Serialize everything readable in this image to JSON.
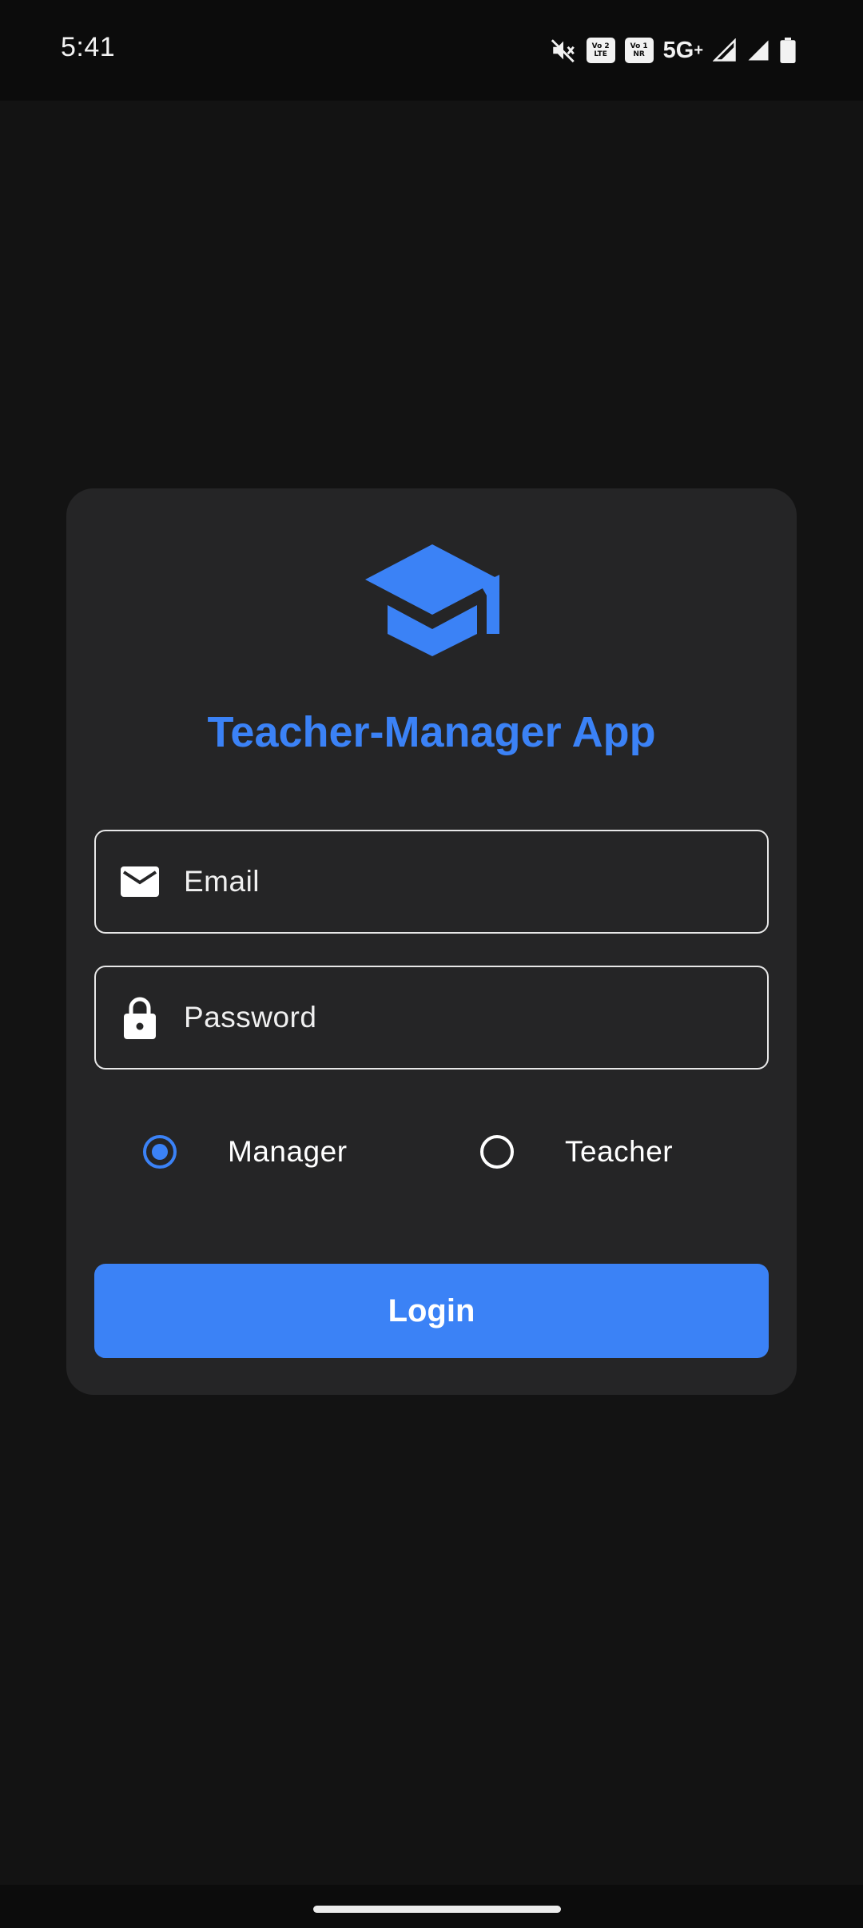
{
  "status_bar": {
    "time": "5:41",
    "sim1": {
      "top": "Vo 2",
      "bottom": "LTE"
    },
    "sim2": {
      "top": "Vo 1",
      "bottom": "NR"
    },
    "network": "5G",
    "network_plus": "+",
    "icons": [
      "mute-icon",
      "volte-lte-icon",
      "vonr-icon",
      "signal-icon",
      "signal-icon",
      "battery-icon"
    ]
  },
  "login_card": {
    "logo_icon": "graduation-cap-icon",
    "title": "Teacher-Manager App",
    "email": {
      "placeholder": "Email",
      "value": "",
      "icon": "envelope-icon"
    },
    "password": {
      "placeholder": "Password",
      "value": "",
      "icon": "lock-icon"
    },
    "roles": [
      {
        "label": "Manager",
        "selected": true
      },
      {
        "label": "Teacher",
        "selected": false
      }
    ],
    "login_label": "Login"
  },
  "colors": {
    "accent": "#3b82f6",
    "background": "#131313",
    "card": "#252526"
  }
}
